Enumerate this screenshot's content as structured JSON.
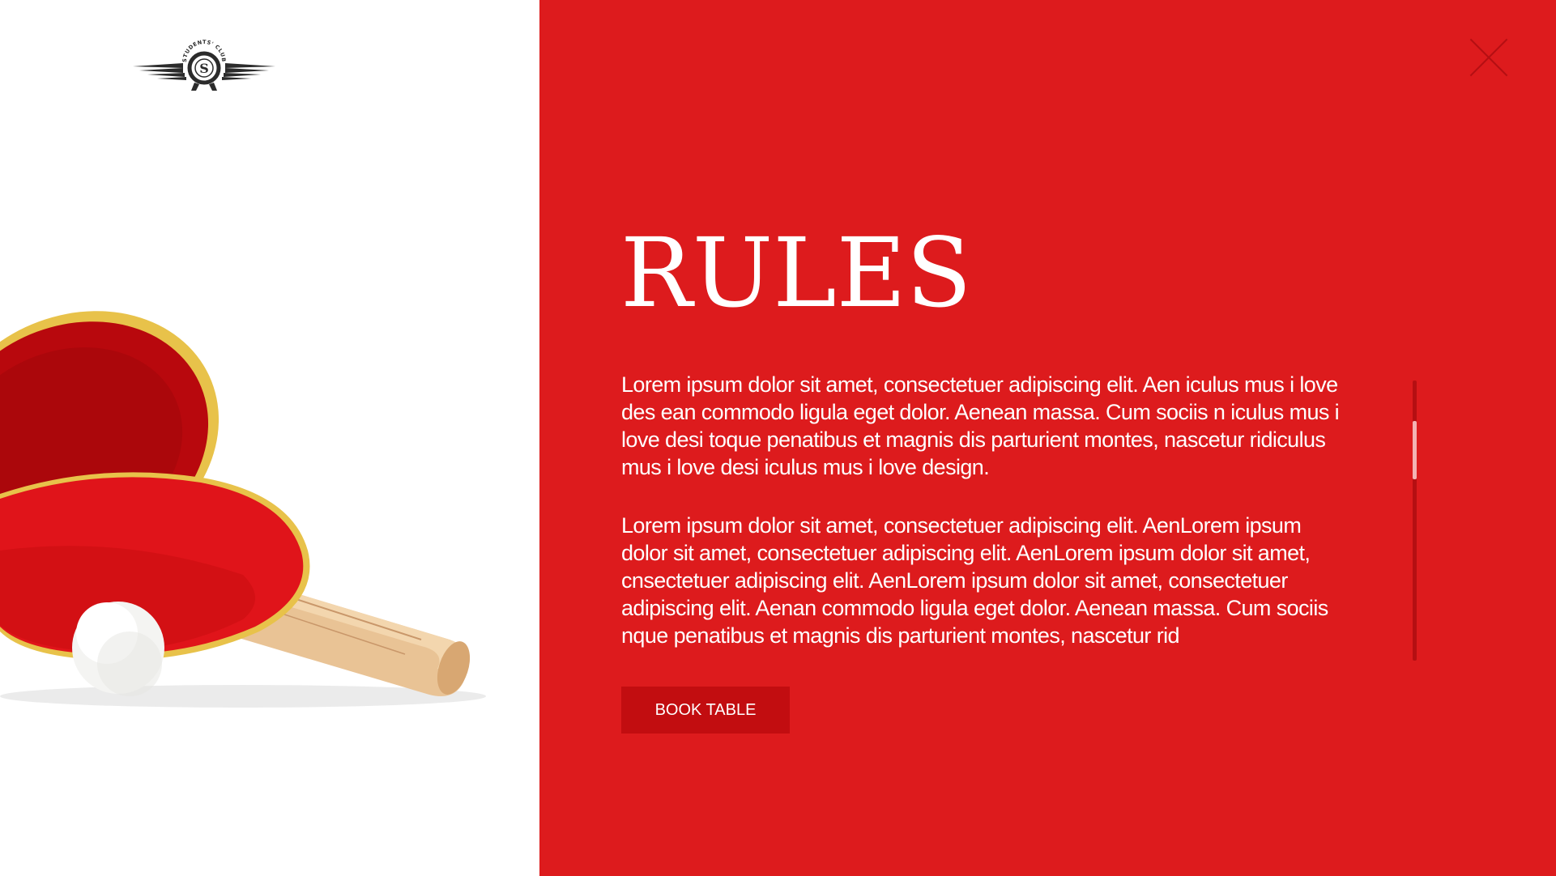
{
  "logo": {
    "arc_text": "STUDENTS' CLUB",
    "monogram": "S"
  },
  "rules": {
    "title": "RULES",
    "paragraphs": [
      "Lorem ipsum dolor sit amet, consectetuer adipiscing elit. Aen iculus mus i love des ean commodo ligula eget dolor. Aenean massa. Cum sociis n iculus mus i love desi toque penatibus et magnis dis parturient montes, nascetur ridiculus mus i love desi iculus mus i love design.",
      "Lorem ipsum dolor sit amet, consectetuer adipiscing elit. AenLorem ipsum dolor sit amet, consectetuer adipiscing elit. AenLorem ipsum dolor sit amet, cnsectetuer adipiscing elit. AenLorem ipsum dolor sit amet, consectetuer adipiscing elit. Aenan commodo ligula eget dolor. Aenean massa. Cum sociis nque penatibus et magnis dis parturient montes, nascetur rid"
    ],
    "book_label": "BOOK TABLE"
  },
  "icons": {
    "close": "close-icon",
    "logo": "wings-logo-icon"
  },
  "colors": {
    "accent": "#dd1b1d",
    "button": "#c20d10",
    "text": "#ffffff"
  },
  "scroll": {
    "position_fraction": 0.14
  }
}
